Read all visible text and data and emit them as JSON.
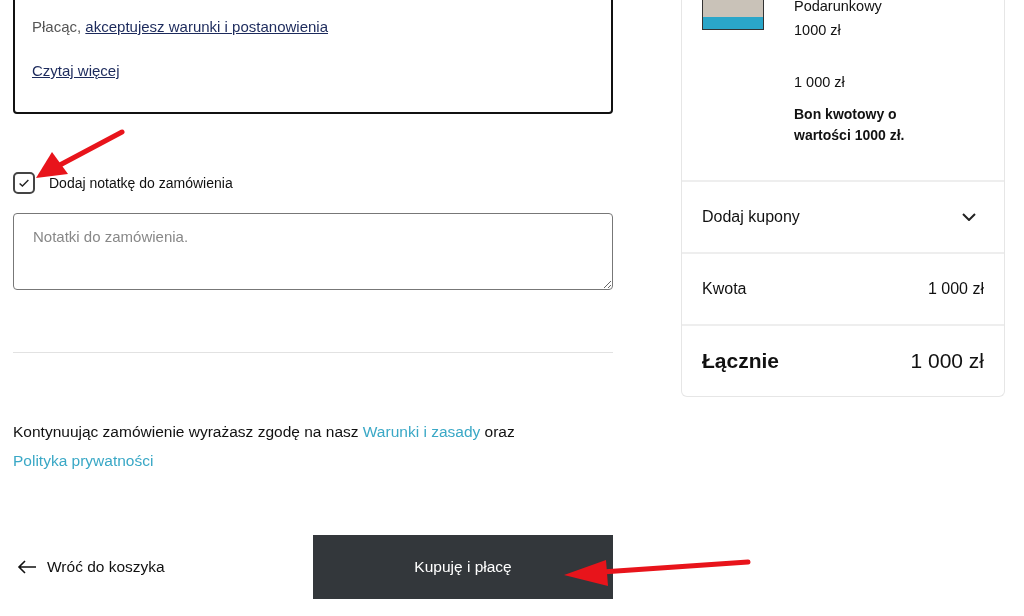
{
  "terms_box": {
    "prefix": "Płacąc,",
    "link": "akceptujesz warunki i postanowienia",
    "read_more": "Czytaj więcej"
  },
  "note_option": {
    "label": "Dodaj notatkę do zamówienia",
    "checked": true
  },
  "note_field": {
    "placeholder": "Notatki do zamówienia."
  },
  "consent": {
    "before": "Kontynuując zamówienie wyrażasz zgodę na nasz",
    "link_1": "Warunki i zasady",
    "middle": "oraz",
    "link_2": "Polityka prywatności"
  },
  "back_link": "Wróć do koszyka",
  "buy_button": "Kupuję i płacę",
  "summary": {
    "product": {
      "name": "Podarunkowy",
      "price": "1000 zł",
      "total": "1 000 zł",
      "description": "Bon kwotowy o wartości 1000 zł."
    },
    "coupons": {
      "label": "Dodaj kupony",
      "expanded": false
    },
    "rows": [
      {
        "kind": "subtotal",
        "label": "Kwota",
        "value": "1 000 zł"
      },
      {
        "kind": "total",
        "label": "Łącznie",
        "value": "1 000 zł"
      }
    ]
  }
}
